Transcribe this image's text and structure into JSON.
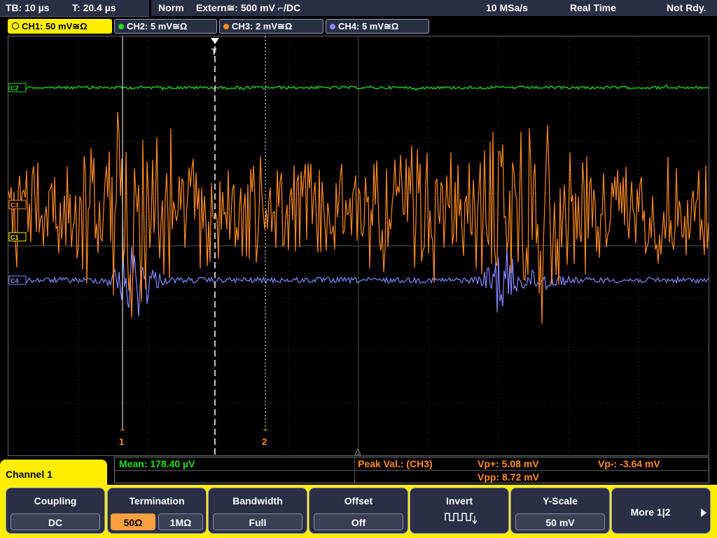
{
  "status": {
    "timebase": "TB: 10 µs",
    "trigger_time": "T: 20.4 µs",
    "mode": "Norm",
    "trigger_source": "Extern≅: 500 mV ⌐/DC",
    "sample_rate": "10 MSa/s",
    "acq_mode": "Real Time",
    "ready_state": "Not Rdy."
  },
  "channels": [
    {
      "label": "CH1: 50 mV≅Ω",
      "color": "#ffee00"
    },
    {
      "label": "CH2: 5 mV≅Ω",
      "color": "#22dd22"
    },
    {
      "label": "CH3: 2 mV≅Ω",
      "color": "#ff8c20"
    },
    {
      "label": "CH4: 5 mV≅Ω",
      "color": "#8888ff"
    }
  ],
  "markers": {
    "c2": "C2",
    "c3": "C3",
    "c1": "C1",
    "c4": "C4",
    "cursor1": "1",
    "cursor2": "2",
    "trigger": "T"
  },
  "measurements": {
    "mean": "Mean: 178.40 µV",
    "peak_label": "Peak Val.: (CH3)",
    "vp_plus": "Vp+: 5.08 mV",
    "vp_minus": "Vp-: -3.64 mV",
    "vpp": "Vpp: 8.72 mV"
  },
  "menu": {
    "title": "Channel 1",
    "coupling": {
      "title": "Coupling",
      "value": "DC"
    },
    "termination": {
      "title": "Termination",
      "opt1": "50Ω",
      "opt2": "1MΩ"
    },
    "bandwidth": {
      "title": "Bandwidth",
      "value": "Full"
    },
    "offset": {
      "title": "Offset",
      "value": "Off"
    },
    "invert": {
      "title": "Invert"
    },
    "yscale": {
      "title": "Y-Scale",
      "value": "50 mV"
    },
    "more": {
      "label": "More 1|2"
    }
  },
  "colors": {
    "ch1": "#ffee00",
    "ch2": "#22dd22",
    "ch3": "#ff8c20",
    "ch4": "#8888ff",
    "panel": "#2a2f46"
  }
}
